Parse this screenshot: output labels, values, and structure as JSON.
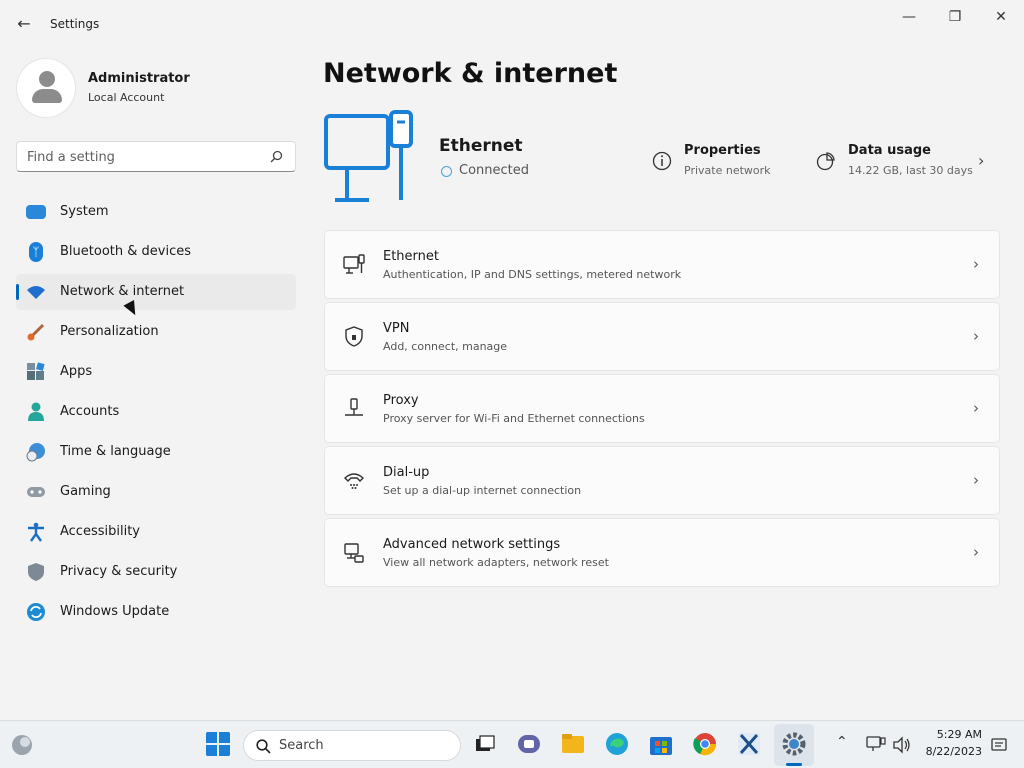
{
  "window": {
    "title": "Settings"
  },
  "profile": {
    "name": "Administrator",
    "account_type": "Local Account"
  },
  "search": {
    "placeholder": "Find a setting"
  },
  "nav": {
    "items": [
      {
        "label": "System",
        "color": "#2b88d8"
      },
      {
        "label": "Bluetooth & devices",
        "color": "#1a7fd6"
      },
      {
        "label": "Network & internet",
        "color": "#1e6fce",
        "active": true
      },
      {
        "label": "Personalization",
        "color": "#e06a2c"
      },
      {
        "label": "Apps",
        "color": "#546e7a"
      },
      {
        "label": "Accounts",
        "color": "#26a69a"
      },
      {
        "label": "Time & language",
        "color": "#3d8fd8"
      },
      {
        "label": "Gaming",
        "color": "#8f9aa3"
      },
      {
        "label": "Accessibility",
        "color": "#1b6ec2"
      },
      {
        "label": "Privacy & security",
        "color": "#7d8a96"
      },
      {
        "label": "Windows Update",
        "color": "#1b8bd4"
      }
    ]
  },
  "main": {
    "title": "Network & internet",
    "connection": {
      "name": "Ethernet",
      "status": "Connected"
    },
    "properties": {
      "title": "Properties",
      "subtitle": "Private network"
    },
    "data_usage": {
      "title": "Data usage",
      "subtitle": "14.22 GB, last 30 days"
    },
    "cards": [
      {
        "title": "Ethernet",
        "subtitle": "Authentication, IP and DNS settings, metered network",
        "icon": "ethernet-icon"
      },
      {
        "title": "VPN",
        "subtitle": "Add, connect, manage",
        "icon": "vpn-shield-icon"
      },
      {
        "title": "Proxy",
        "subtitle": "Proxy server for Wi-Fi and Ethernet connections",
        "icon": "proxy-icon"
      },
      {
        "title": "Dial-up",
        "subtitle": "Set up a dial-up internet connection",
        "icon": "dialup-icon"
      },
      {
        "title": "Advanced network settings",
        "subtitle": "View all network adapters, network reset",
        "icon": "advanced-network-icon"
      }
    ]
  },
  "taskbar": {
    "search_label": "Search",
    "time": "5:29 AM",
    "date": "8/22/2023"
  },
  "colors": {
    "accent": "#0067c0",
    "hero": "#1a7fd6"
  }
}
